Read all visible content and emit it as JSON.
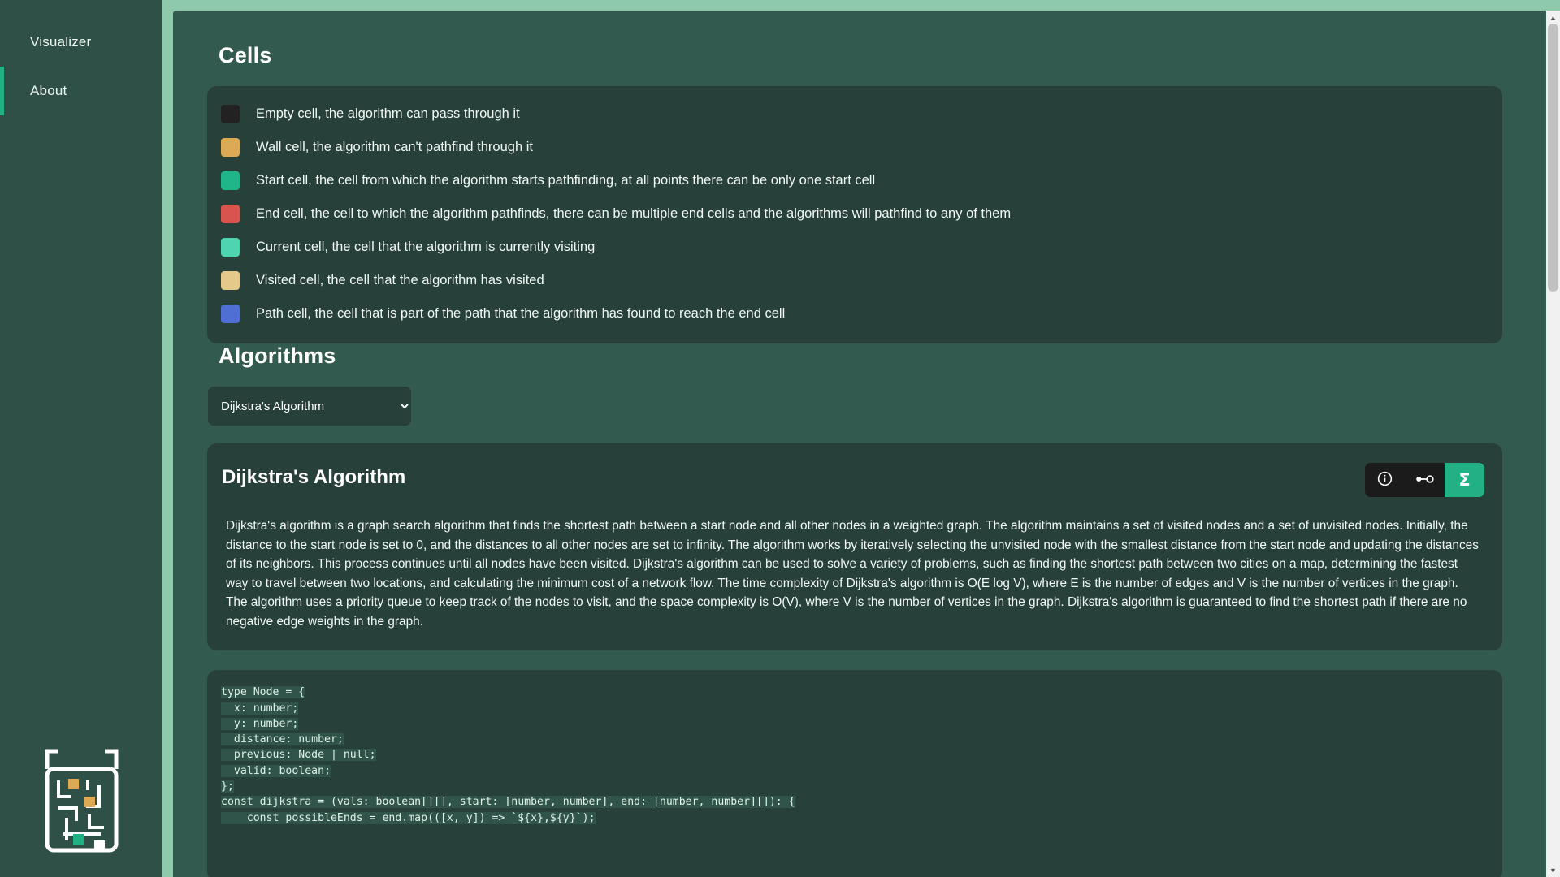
{
  "sidebar": {
    "items": [
      {
        "label": "Visualizer",
        "active": false,
        "name": "sidebar-item-visualizer"
      },
      {
        "label": "About",
        "active": true,
        "name": "sidebar-item-about"
      }
    ],
    "logo_alt": "maze-robot-logo"
  },
  "cells": {
    "heading": "Cells",
    "rows": [
      {
        "color": "#222222",
        "text": "Empty cell, the algorithm can pass through it",
        "name": "legend-empty-cell"
      },
      {
        "color": "#dcaa55",
        "text": "Wall cell, the algorithm can't pathfind through it",
        "name": "legend-wall-cell"
      },
      {
        "color": "#1fb789",
        "text": "Start cell, the cell from which the algorithm starts pathfinding, at all points there can be only one start cell",
        "name": "legend-start-cell"
      },
      {
        "color": "#d9534f",
        "text": "End cell, the cell to which the algorithm pathfinds, there can be multiple end cells and the algorithms will pathfind to any of them",
        "name": "legend-end-cell"
      },
      {
        "color": "#4ed4ae",
        "text": "Current cell, the cell that the algorithm is currently visiting",
        "name": "legend-current-cell"
      },
      {
        "color": "#e5c98a",
        "text": "Visited cell, the cell that the algorithm has visited",
        "name": "legend-visited-cell"
      },
      {
        "color": "#4f6fd4",
        "text": "Path cell, the cell that is part of the path that the algorithm has found to reach the end cell",
        "name": "legend-path-cell"
      }
    ]
  },
  "algorithms": {
    "heading": "Algorithms",
    "selected": "Dijkstra's Algorithm",
    "options": [
      "Dijkstra's Algorithm"
    ],
    "card": {
      "title": "Dijkstra's Algorithm",
      "description": "Dijkstra's algorithm is a graph search algorithm that finds the shortest path between a start node and all other nodes in a weighted graph. The algorithm maintains a set of visited nodes and a set of unvisited nodes. Initially, the distance to the start node is set to 0, and the distances to all other nodes are set to infinity. The algorithm works by iteratively selecting the unvisited node with the smallest distance from the start node and updating the distances of its neighbors. This process continues until all nodes have been visited. Dijkstra's algorithm can be used to solve a variety of problems, such as finding the shortest path between two cities on a map, determining the fastest way to travel between two locations, and calculating the minimum cost of a network flow. The time complexity of Dijkstra's algorithm is O(E log V), where E is the number of edges and V is the number of vertices in the graph. The algorithm uses a priority queue to keep track of the nodes to visit, and the space complexity is O(V), where V is the number of vertices in the graph. Dijkstra's algorithm is guaranteed to find the shortest path if there are no negative edge weights in the graph.",
      "buttons": [
        {
          "icon": "info-icon",
          "label": "i",
          "active": false
        },
        {
          "icon": "graph-node-icon",
          "label": "",
          "active": false
        },
        {
          "icon": "sigma-icon",
          "label": "Σ",
          "active": true
        }
      ]
    },
    "code": [
      "type Node = {",
      "  x: number;",
      "  y: number;",
      "  distance: number;",
      "  previous: Node | null;",
      "  valid: boolean;",
      "};",
      "const dijkstra = (vals: boolean[][], start: [number, number], end: [number, number][]): {",
      "    const possibleEnds = end.map(([x, y]) => `${x},${y}`);"
    ]
  },
  "colors": {
    "accent": "#22b185",
    "page_bg": "#2f5047",
    "panel_bg": "#335a4e",
    "card_bg": "#27403a",
    "frame_bg": "#8ec9ab"
  },
  "scrollbar": {
    "up": "▲",
    "down": "▼"
  }
}
